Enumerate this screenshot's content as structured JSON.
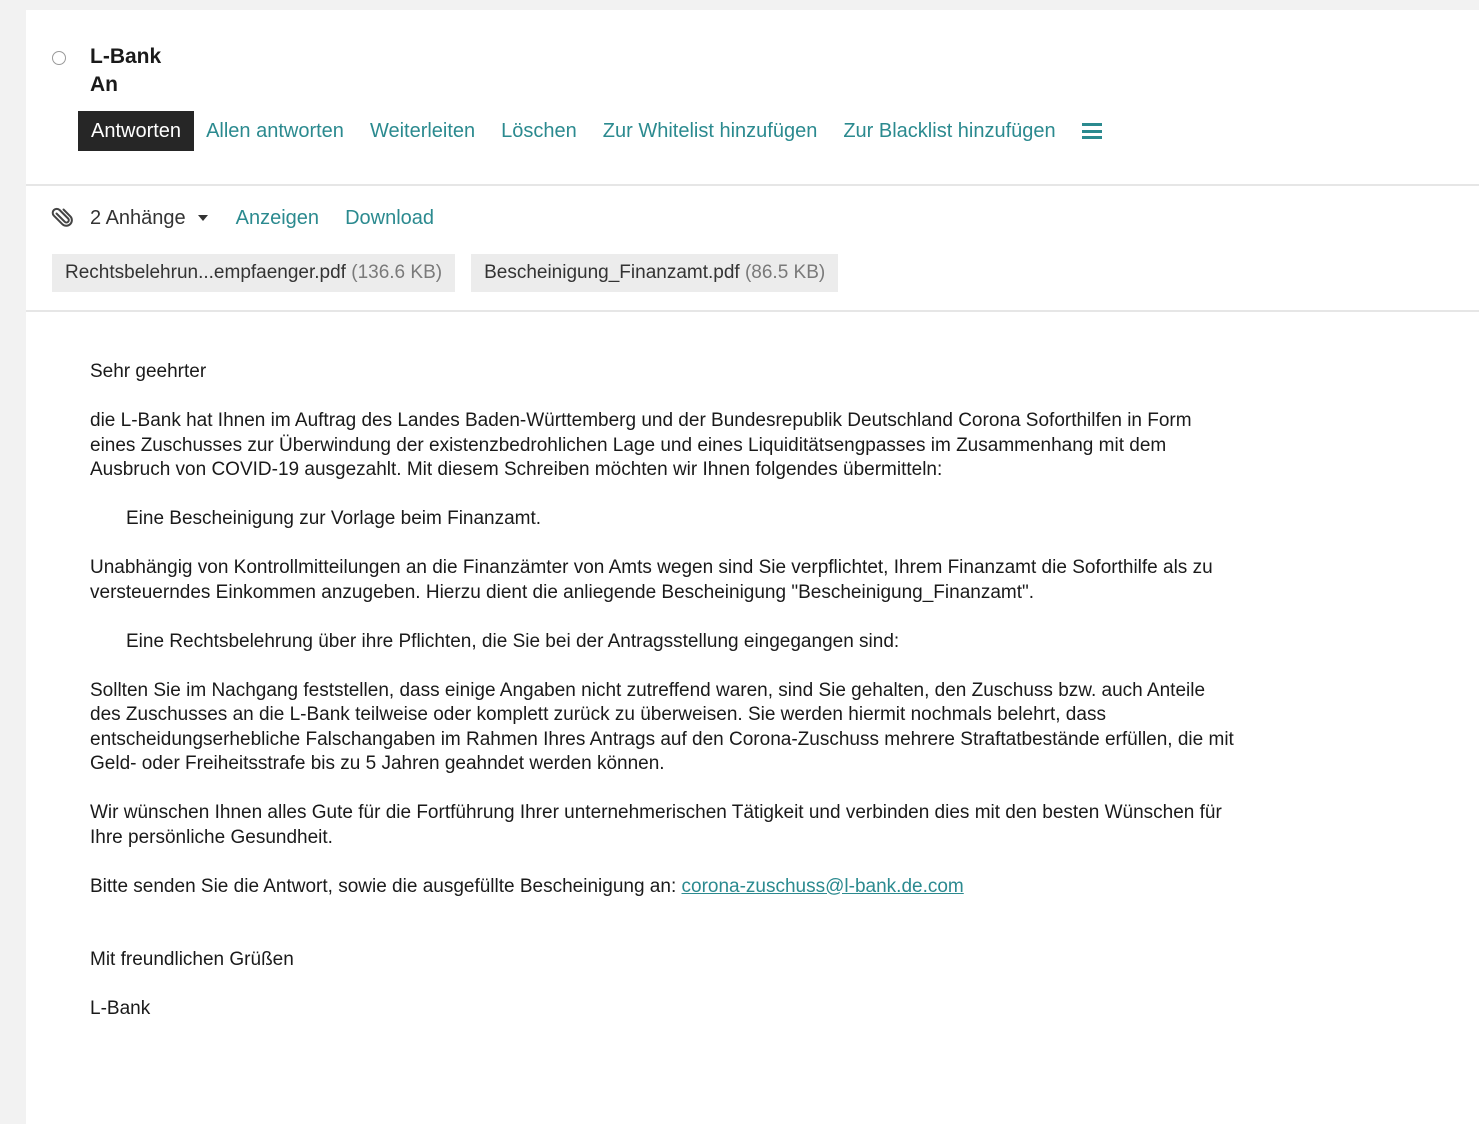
{
  "header": {
    "sender": "L-Bank",
    "recipient_label": "An"
  },
  "actions": {
    "reply": "Antworten",
    "reply_all": "Allen antworten",
    "forward": "Weiterleiten",
    "delete": "Löschen",
    "whitelist": "Zur Whitelist hinzufügen",
    "blacklist": "Zur Blacklist hinzufügen",
    "menu_icon": "hamburger-menu-icon"
  },
  "attachments": {
    "icon": "paperclip-icon",
    "count_label": "2 Anhänge",
    "view_label": "Anzeigen",
    "download_label": "Download",
    "files": [
      {
        "name": "Rechtsbelehrun...empfaenger.pdf",
        "size": "(136.6 KB)"
      },
      {
        "name": "Bescheinigung_Finanzamt.pdf",
        "size": "(86.5 KB)"
      }
    ]
  },
  "colors": {
    "link": "#2b8a8f",
    "primary_button_bg": "#262626"
  },
  "body": {
    "greeting": "Sehr geehrter",
    "para1": "die L-Bank hat Ihnen im Auftrag des Landes Baden-Württemberg und der Bundesrepublik Deutschland Corona Soforthilfen in Form eines Zuschusses zur Überwindung der existenzbedrohlichen Lage und eines Liquiditätsengpasses im Zusammenhang mit dem Ausbruch von COVID-19 ausgezahlt. Mit diesem Schreiben möchten wir Ihnen folgendes übermitteln:",
    "item1": "Eine Bescheinigung zur Vorlage beim Finanzamt.",
    "para2": "Unabhängig von Kontrollmitteilungen an die Finanzämter von Amts wegen sind Sie verpflichtet, Ihrem Finanzamt die Soforthilfe als zu versteuerndes Einkommen anzugeben. Hierzu dient die anliegende Bescheinigung \"Bescheinigung_Finanzamt\".",
    "item2": "Eine Rechtsbelehrung über ihre Pflichten, die Sie bei der Antragsstellung eingegangen sind:",
    "para3": "Sollten Sie im Nachgang feststellen, dass einige Angaben nicht zutreffend waren, sind Sie gehalten, den Zuschuss bzw. auch Anteile des Zuschusses an die L-Bank teilweise oder komplett zurück zu überweisen. Sie werden hiermit nochmals belehrt, dass entscheidungserhebliche Falschangaben im Rahmen Ihres Antrags auf den Corona-Zuschuss mehrere Straftatbestände erfüllen, die mit Geld- oder Freiheitsstrafe bis zu 5 Jahren geahndet werden können.",
    "para4": "Wir wünschen Ihnen alles Gute für die Fortführung Ihrer unternehmerischen Tätigkeit und verbinden dies mit den besten Wünschen für Ihre persönliche Gesundheit.",
    "para5_prefix": "Bitte senden Sie die Antwort, sowie die ausgefüllte Bescheinigung an: ",
    "email": "corona-zuschuss@l-bank.de.com",
    "closing": "Mit freundlichen Grüßen",
    "signature": "L-Bank"
  }
}
